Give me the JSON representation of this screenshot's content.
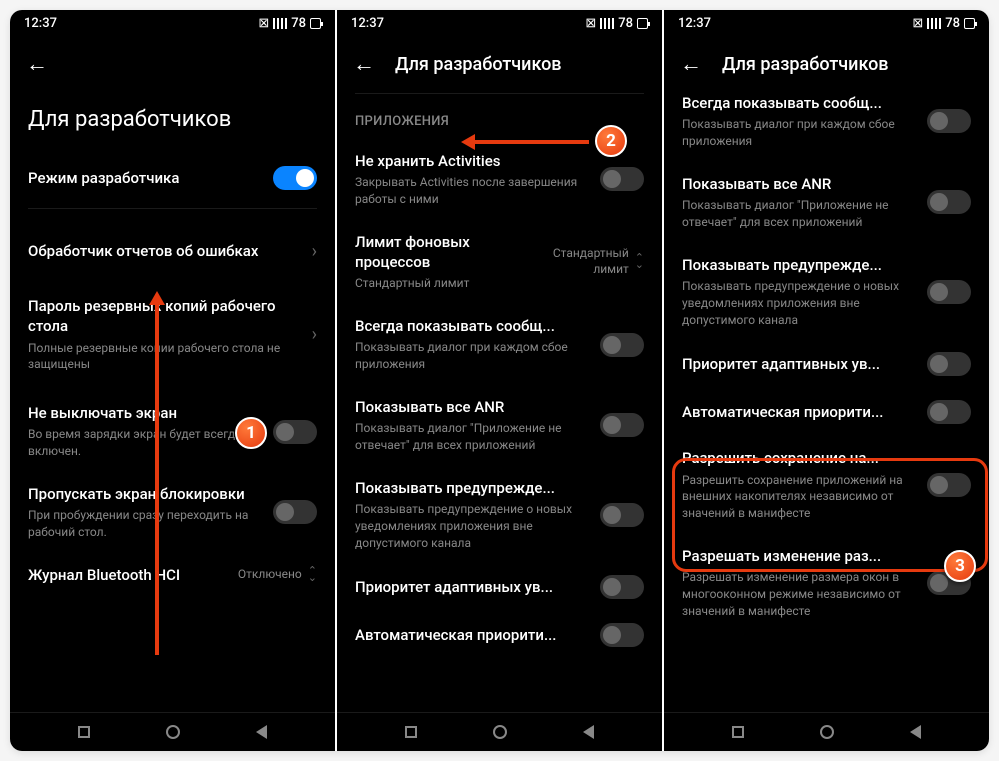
{
  "status": {
    "time": "12:37",
    "battery": "78"
  },
  "screen1": {
    "title": "Для разработчиков",
    "devmode": {
      "label": "Режим разработчика"
    },
    "r1": {
      "title": "Обработчик отчетов об ошибках"
    },
    "r2": {
      "title": "Пароль резервных копий рабочего стола",
      "sub": "Полные резервные копии рабочего стола не защищены"
    },
    "r3": {
      "title": "Не выключать экран",
      "sub": "Во время зарядки экран будет всегда включен."
    },
    "r4": {
      "title": "Пропускать экран блокировки",
      "sub": "При пробуждении сразу переходить на рабочий стол."
    },
    "r5": {
      "title": "Журнал Bluetooth HCI",
      "val": "Отключено"
    }
  },
  "screen2": {
    "header": "Для разработчиков",
    "section": "ПРИЛОЖЕНИЯ",
    "r1": {
      "title": "Не хранить Activities",
      "sub": "Закрывать Activities после завершения работы с ними"
    },
    "r2": {
      "title": "Лимит фоновых процессов",
      "sub": "Стандартный лимит",
      "val": "Стандартный\nлимит"
    },
    "r3": {
      "title": "Всегда показывать сообщ...",
      "sub": "Показывать диалог при каждом сбое приложения"
    },
    "r4": {
      "title": "Показывать все ANR",
      "sub": "Показывать диалог \"Приложение не отвечает\" для всех приложений"
    },
    "r5": {
      "title": "Показывать предупрежде...",
      "sub": "Показывать предупреждение о новых уведомлениях приложения вне допустимого канала"
    },
    "r6": {
      "title": "Приоритет адаптивных ув..."
    },
    "r7": {
      "title": "Автоматическая приорити..."
    }
  },
  "screen3": {
    "header": "Для разработчиков",
    "r1": {
      "title": "Всегда показывать сообщ...",
      "sub": "Показывать диалог при каждом сбое приложения"
    },
    "r2": {
      "title": "Показывать все ANR",
      "sub": "Показывать диалог \"Приложение не отвечает\" для всех приложений"
    },
    "r3": {
      "title": "Показывать предупрежде...",
      "sub": "Показывать предупреждение о новых уведомлениях приложения вне допустимого канала"
    },
    "r4": {
      "title": "Приоритет адаптивных ув..."
    },
    "r5": {
      "title": "Автоматическая приорити..."
    },
    "r6": {
      "title": "Разрешить сохранение на...",
      "sub": "Разрешить сохранение приложений на внешних накопителях независимо от значений в манифесте"
    },
    "r7": {
      "title": "Разрешать изменение раз...",
      "sub": "Разрешать изменение размера окон в многооконном режиме независимо от значений в манифесте"
    }
  },
  "markers": {
    "m1": "1",
    "m2": "2",
    "m3": "3"
  }
}
